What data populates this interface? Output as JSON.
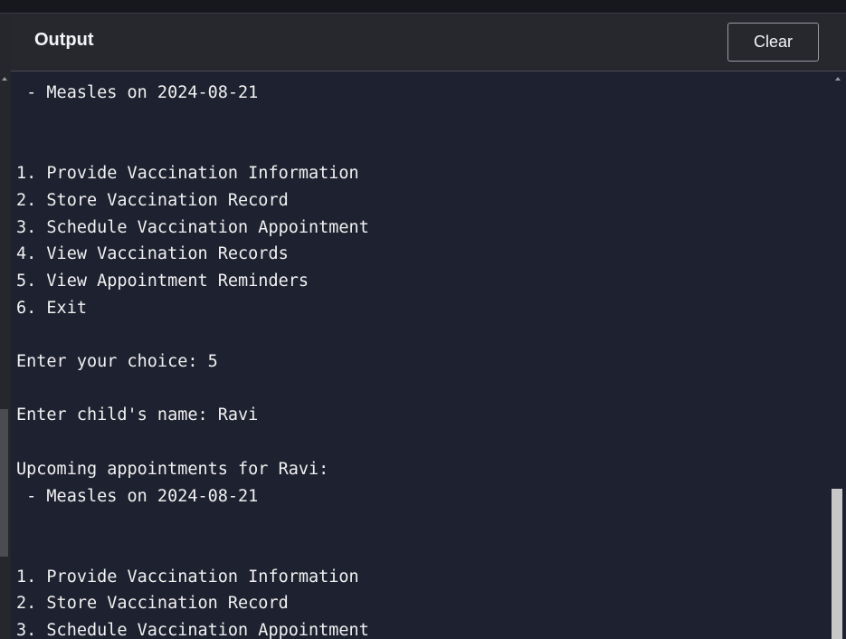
{
  "header": {
    "title": "Output",
    "clear_label": "Clear"
  },
  "console": {
    "text": " - Measles on 2024-08-21\n\n\n1. Provide Vaccination Information\n2. Store Vaccination Record\n3. Schedule Vaccination Appointment\n4. View Vaccination Records\n5. View Appointment Reminders\n6. Exit\n\nEnter your choice: 5\n\nEnter child's name: Ravi\n\nUpcoming appointments for Ravi:\n - Measles on 2024-08-21\n\n\n1. Provide Vaccination Information\n2. Store Vaccination Record\n3. Schedule Vaccination Appointment"
  },
  "colors": {
    "background": "#1e2130",
    "header": "#26282e",
    "text": "#f1f1f1"
  }
}
